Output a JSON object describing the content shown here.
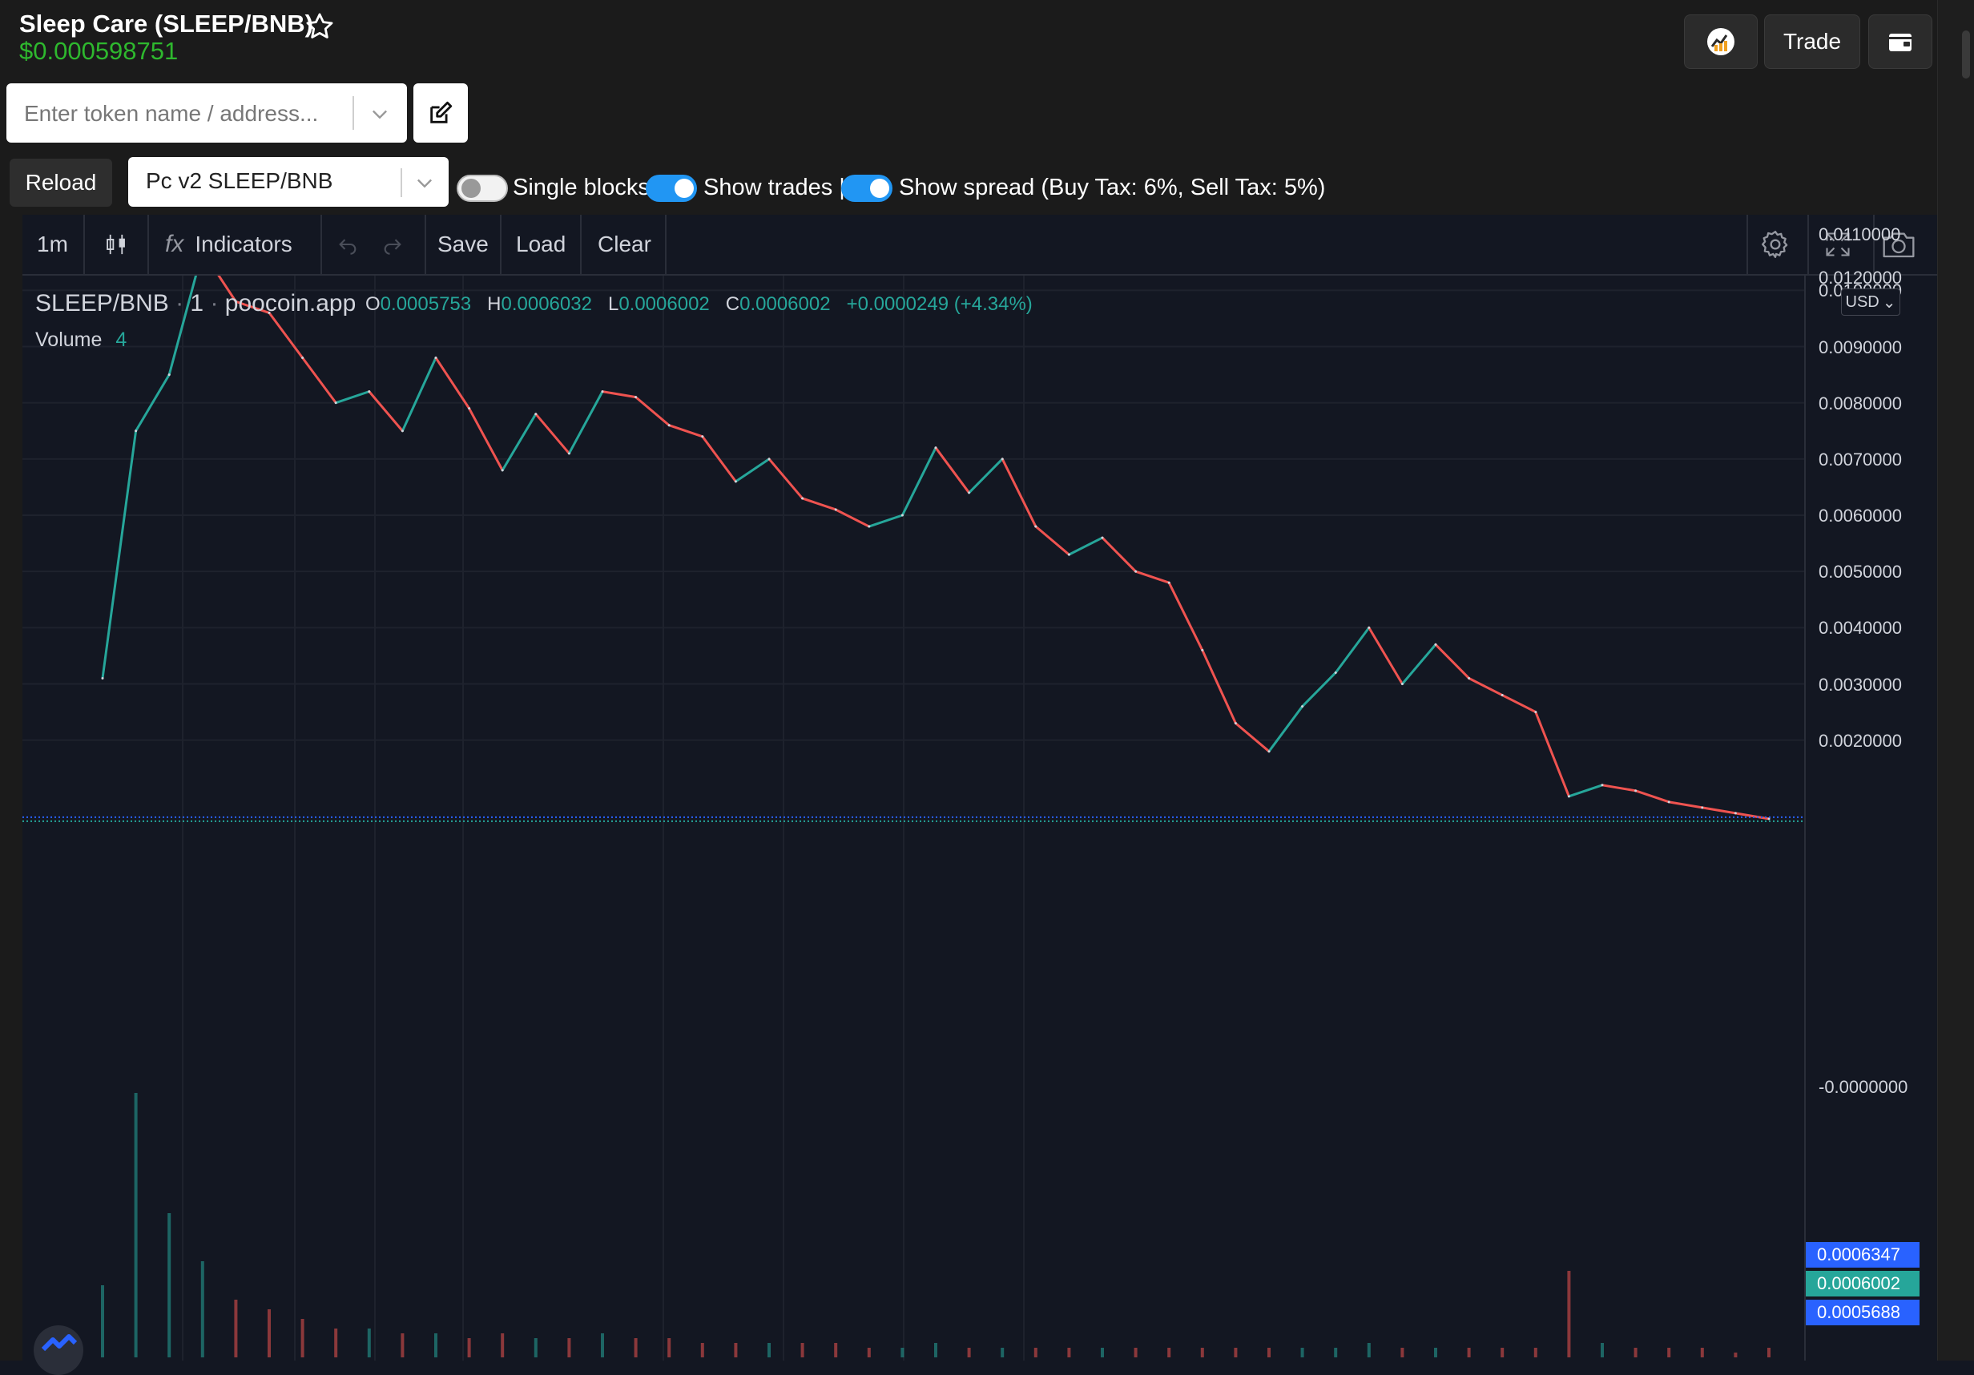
{
  "header": {
    "title": "Sleep Care (SLEEP/BNB)",
    "price": "$0.000598751",
    "trade_label": "Trade"
  },
  "search": {
    "placeholder": "Enter token name / address..."
  },
  "controls": {
    "reload_label": "Reload",
    "pair_value": "Pc v2 SLEEP/BNB",
    "single_blocks_label": "Single blocks",
    "single_blocks_on": false,
    "show_trades_label": "Show trades |",
    "show_trades_on": true,
    "show_spread_label": "Show spread (Buy Tax: 6%, Sell Tax: 5%)",
    "show_spread_on": true
  },
  "toolbar": {
    "interval": "1m",
    "indicators": "Indicators",
    "save": "Save",
    "load": "Load",
    "clear": "Clear"
  },
  "legend": {
    "symbol": "SLEEP/BNB",
    "interval": "1",
    "source": "poocoin.app",
    "o_label": "O",
    "o_value": "0.0005753",
    "h_label": "H",
    "h_value": "0.0006032",
    "l_label": "L",
    "l_value": "0.0006002",
    "c_label": "C",
    "c_value": "0.0006002",
    "change": "+0.0000249 (+4.34%)",
    "volume_label": "Volume",
    "volume_value": "4"
  },
  "axis": {
    "currency": "USD",
    "top_partial": "0.0120000",
    "ticks": [
      "0.0110000",
      "0.0100000",
      "0.0090000",
      "0.0080000",
      "0.0070000",
      "0.0060000",
      "0.0050000",
      "0.0040000",
      "0.0030000",
      "0.0020000",
      "-0.0000000"
    ],
    "tag_high": "0.0006347",
    "tag_last": "0.0006002",
    "tag_low": "0.0005688"
  },
  "colors": {
    "up": "#26a69a",
    "down": "#ef5350",
    "price_green": "#2eb82e",
    "toggle_on": "#2196f3",
    "tag_blue": "#2962ff",
    "tag_green": "#26a69a"
  },
  "chart_data": {
    "type": "line",
    "x": [
      0,
      2,
      4,
      6,
      8,
      10,
      12,
      14,
      16,
      18,
      20,
      22,
      24,
      26,
      28,
      30,
      32,
      34,
      36,
      38,
      40,
      42,
      44,
      46,
      48,
      50,
      52,
      54,
      56,
      58,
      60,
      62,
      64,
      66,
      68,
      70,
      72,
      74,
      76,
      78,
      80,
      82,
      84,
      86,
      88,
      90,
      92,
      94,
      96,
      98,
      100
    ],
    "series": [
      {
        "values": [
          0.0031,
          0.0075,
          0.0085,
          0.0107,
          0.0098,
          0.0096,
          0.0088,
          0.008,
          0.0082,
          0.0075,
          0.0088,
          0.0079,
          0.0068,
          0.0078,
          0.0071,
          0.0082,
          0.0081,
          0.0076,
          0.0074,
          0.0066,
          0.007,
          0.0063,
          0.0061,
          0.0058,
          0.006,
          0.0072,
          0.0064,
          0.007,
          0.0058,
          0.0053,
          0.0056,
          0.005,
          0.0048,
          0.0036,
          0.0023,
          0.0018,
          0.0026,
          0.0032,
          0.004,
          0.003,
          0.0037,
          0.0031,
          0.0028,
          0.0025,
          0.001,
          0.0012,
          0.0011,
          0.0009,
          0.0008,
          0.0007,
          0.0006
        ]
      }
    ],
    "volume_values": [
      0.15,
      0.55,
      0.3,
      0.2,
      0.12,
      0.1,
      0.08,
      0.06,
      0.06,
      0.05,
      0.05,
      0.04,
      0.05,
      0.04,
      0.04,
      0.05,
      0.04,
      0.04,
      0.03,
      0.03,
      0.03,
      0.03,
      0.03,
      0.02,
      0.02,
      0.03,
      0.02,
      0.02,
      0.02,
      0.02,
      0.02,
      0.02,
      0.02,
      0.02,
      0.02,
      0.02,
      0.02,
      0.02,
      0.03,
      0.02,
      0.02,
      0.02,
      0.02,
      0.02,
      0.18,
      0.03,
      0.02,
      0.02,
      0.02,
      0.01,
      0.02
    ],
    "ylim": [
      0,
      0.012
    ]
  }
}
